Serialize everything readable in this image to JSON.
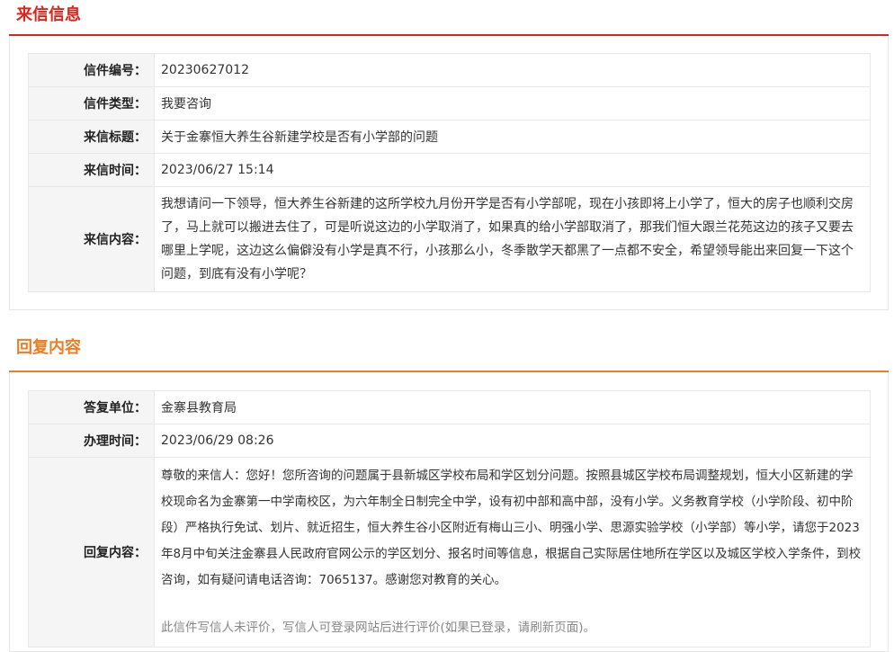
{
  "sections": {
    "letter": {
      "title": "来信信息",
      "color": "#d8261c"
    },
    "reply": {
      "title": "回复内容",
      "color": "#ee7d22"
    }
  },
  "letter": {
    "rows": [
      {
        "label": "信件编号：",
        "value": "20230627012"
      },
      {
        "label": "信件类型：",
        "value": "我要咨询"
      },
      {
        "label": "来信标题：",
        "value": "关于金寨恒大养生谷新建学校是否有小学部的问题"
      },
      {
        "label": "来信时间：",
        "value": "2023/06/27 15:14"
      },
      {
        "label": "来信内容：",
        "value": "我想请问一下领导，恒大养生谷新建的这所学校九月份开学是否有小学部呢，现在小孩即将上小学了，恒大的房子也顺利交房了，马上就可以搬进去住了，可是听说这边的小学取消了，如果真的给小学部取消了，那我们恒大跟兰花苑这边的孩子又要去哪里上学呢，这边这么偏僻没有小学是真不行，小孩那么小，冬季散学天都黑了一点都不安全，希望领导能出来回复一下这个问题，到底有没有小学呢？"
      }
    ]
  },
  "reply": {
    "rows": [
      {
        "label": "答复单位：",
        "value": "金寨县教育局"
      },
      {
        "label": "办理时间：",
        "value": "2023/06/29 08:26"
      },
      {
        "label": "回复内容：",
        "value": "尊敬的来信人：您好！您所咨询的问题属于县新城区学校布局和学区划分问题。按照县城区学校布局调整规划，恒大小区新建的学校现命名为金寨第一中学南校区，为六年制全日制完全中学，设有初中部和高中部，没有小学。义务教育学校（小学阶段、初中阶段）严格执行免试、划片、就近招生，恒大养生谷小区附近有梅山三小、明强小学、思源实验学校（小学部）等小学，请您于2023年8月中旬关注金寨县人民政府官网公示的学区划分、报名时间等信息，根据自己实际居住地所在学区以及城区学校入学条件，到校咨询，如有疑问请电话咨询：7065137。感谢您对教育的关心。"
      }
    ],
    "evaluation_note": "此信件写信人未评价，写信人可登录网站后进行评价(如果已登录，请刷新页面)。"
  }
}
